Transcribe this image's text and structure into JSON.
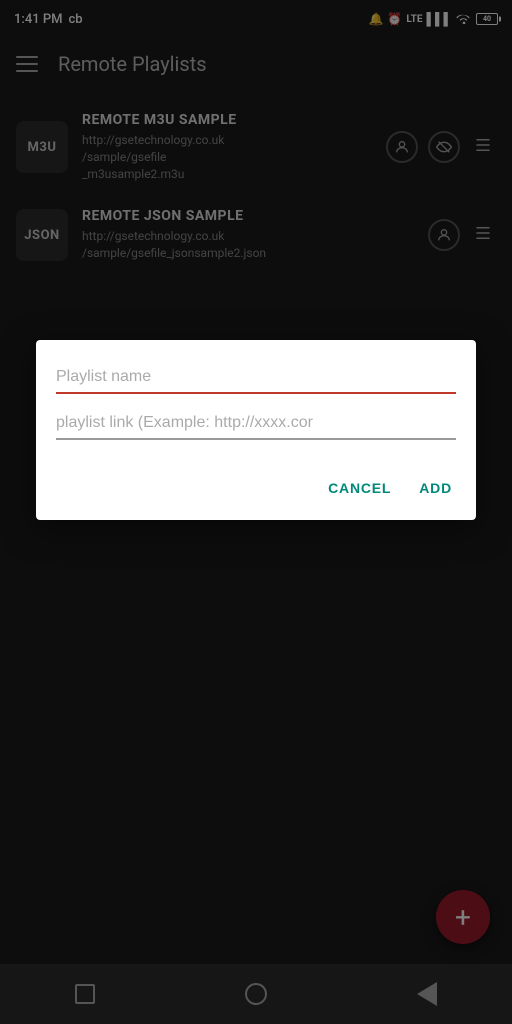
{
  "status": {
    "time": "1:41 PM",
    "carrier": "cb",
    "battery_level": "40"
  },
  "app_bar": {
    "title": "Remote Playlists"
  },
  "playlists": [
    {
      "id": 1,
      "badge": "M3U",
      "name": "REMOTE M3U SAMPLE",
      "url": "http://gsetechnology.co.uk/sample/gsefile_m3usample2.m3u",
      "has_eye_icon": true,
      "has_user_icon": true
    },
    {
      "id": 2,
      "badge": "JSON",
      "name": "REMOTE JSON SAMPLE",
      "url": "http://gsetechnology.co.uk/sample/gsefile_jsonsample2.json",
      "has_eye_icon": false,
      "has_user_icon": true
    }
  ],
  "dialog": {
    "name_placeholder": "Playlist name",
    "link_placeholder": "playlist link (Example: http://xxxx.cor",
    "cancel_label": "CANCEL",
    "add_label": "ADD"
  },
  "fab": {
    "icon": "+"
  }
}
